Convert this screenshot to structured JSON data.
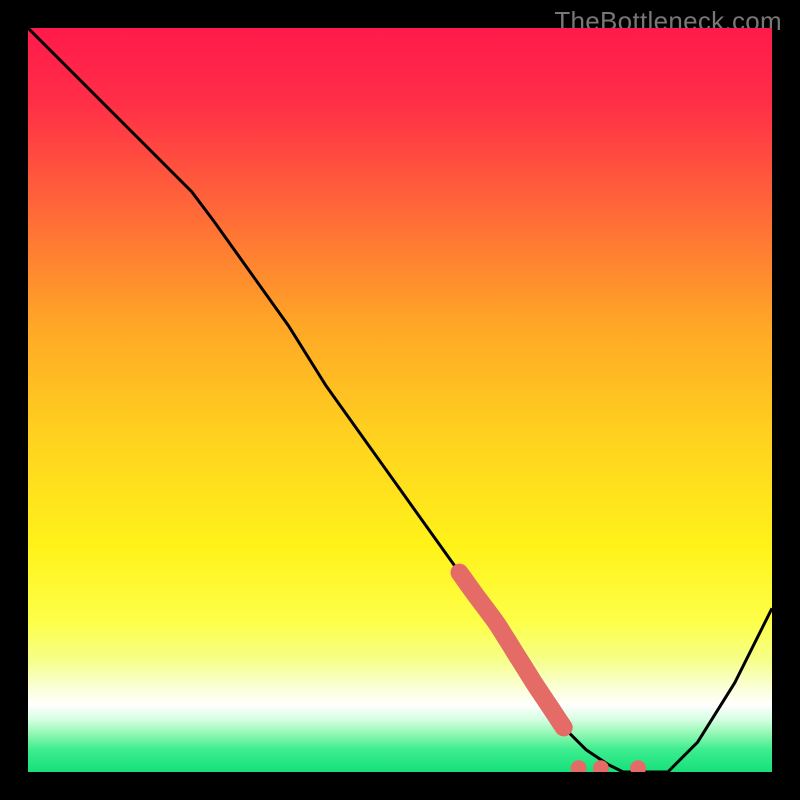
{
  "watermark": "TheBottleneck.com",
  "colors": {
    "curve": "#000000",
    "highlight": "#e46b66",
    "dot": "#e46b66",
    "frame_bg": "#000000"
  },
  "chart_data": {
    "type": "line",
    "title": "",
    "xlabel": "",
    "ylabel": "",
    "xlim": [
      0,
      100
    ],
    "ylim": [
      0,
      100
    ],
    "grid": false,
    "legend": false,
    "series": [
      {
        "name": "bottleneck-curve",
        "x": [
          0,
          5,
          10,
          15,
          20,
          22,
          25,
          30,
          35,
          40,
          45,
          50,
          55,
          60,
          63,
          68,
          72,
          75,
          78,
          80,
          83,
          86,
          90,
          95,
          100
        ],
        "y": [
          100,
          95,
          90,
          85,
          80,
          78,
          74,
          67,
          60,
          52,
          45,
          38,
          31,
          24,
          20,
          12,
          6,
          3,
          1,
          0,
          0,
          0,
          4,
          12,
          22
        ]
      }
    ],
    "annotations": {
      "highlight_segment": {
        "x_start": 58,
        "x_end": 72,
        "style": "thick-salmon"
      },
      "dots": [
        {
          "x": 74,
          "y": 0.5
        },
        {
          "x": 77,
          "y": 0.5
        },
        {
          "x": 82,
          "y": 0.5
        }
      ]
    },
    "background_gradient": {
      "type": "vertical",
      "stops": [
        {
          "pos": 0.0,
          "color": "#ff1a4b"
        },
        {
          "pos": 0.1,
          "color": "#ff2e47"
        },
        {
          "pos": 0.25,
          "color": "#ff6a38"
        },
        {
          "pos": 0.4,
          "color": "#ffa726"
        },
        {
          "pos": 0.55,
          "color": "#ffd21f"
        },
        {
          "pos": 0.7,
          "color": "#fff31a"
        },
        {
          "pos": 0.8,
          "color": "#fdff4a"
        },
        {
          "pos": 0.85,
          "color": "#f6ff8a"
        },
        {
          "pos": 0.88,
          "color": "#f9ffc9"
        },
        {
          "pos": 0.91,
          "color": "#ffffff"
        },
        {
          "pos": 0.93,
          "color": "#d4ffe0"
        },
        {
          "pos": 0.95,
          "color": "#8cf7b0"
        },
        {
          "pos": 0.97,
          "color": "#3ded8e"
        },
        {
          "pos": 1.0,
          "color": "#15e07a"
        }
      ]
    }
  }
}
